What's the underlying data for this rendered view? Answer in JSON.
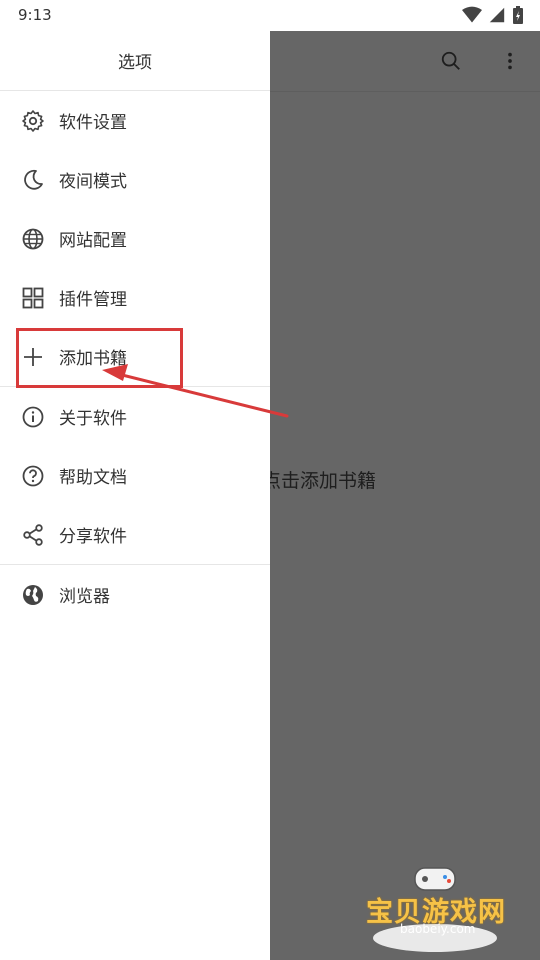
{
  "status_bar": {
    "time": "9:13"
  },
  "drawer": {
    "title": "选项",
    "groups": [
      {
        "items": [
          {
            "label": "软件设置",
            "icon": "gear-icon"
          },
          {
            "label": "夜间模式",
            "icon": "moon-icon"
          },
          {
            "label": "网站配置",
            "icon": "globe-icon"
          },
          {
            "label": "插件管理",
            "icon": "grid-icon"
          },
          {
            "label": "添加书籍",
            "icon": "plus-icon"
          }
        ]
      },
      {
        "items": [
          {
            "label": "关于软件",
            "icon": "info-icon"
          },
          {
            "label": "帮助文档",
            "icon": "help-icon"
          },
          {
            "label": "分享软件",
            "icon": "share-icon"
          }
        ]
      },
      {
        "items": [
          {
            "label": "浏览器",
            "icon": "earth-icon"
          }
        ]
      }
    ]
  },
  "background": {
    "empty_hint": "点击添加书籍"
  },
  "watermark": {
    "brand": "宝贝游戏网",
    "url": "baobeiy.com"
  },
  "colors": {
    "annotation_red": "#d83a3a",
    "dim_overlay": "#666666",
    "icon_gray": "#444444"
  }
}
